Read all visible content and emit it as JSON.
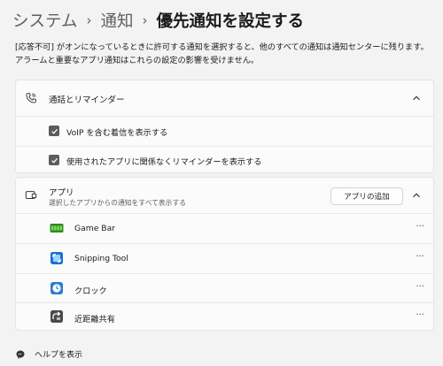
{
  "breadcrumb": {
    "items": [
      "システム",
      "通知"
    ],
    "current": "優先通知を設定する",
    "separator": "›"
  },
  "description": "[応答不可] がオンになっているときに許可する通知を選択すると、他のすべての通知は通知センターに残ります。アラームと重要なアプリ通知はこれらの設定の影響を受けません。",
  "calls_section": {
    "title": "通話とリマインダー",
    "icon": "phone-icon",
    "options": [
      {
        "label": "VoIP を含む着信を表示する",
        "checked": true
      },
      {
        "label": "使用されたアプリに関係なくリマインダーを表示する",
        "checked": true
      }
    ]
  },
  "apps_section": {
    "title": "アプリ",
    "subtitle": "選択したアプリからの通知をすべて表示する",
    "icon": "app-window-icon",
    "add_button": "アプリの追加",
    "apps": [
      {
        "name": "Game Bar",
        "icon": "game-bar-icon",
        "more": "···"
      },
      {
        "name": "Snipping Tool",
        "icon": "snipping-tool-icon",
        "more": "···"
      },
      {
        "name": "クロック",
        "icon": "clock-icon",
        "more": "···"
      },
      {
        "name": "近距離共有",
        "icon": "nearby-share-icon",
        "more": "···"
      }
    ]
  },
  "help": {
    "label": "ヘルプを表示",
    "icon": "help-icon"
  },
  "colors": {
    "background": "#f3f3f3",
    "card": "#fbfbfb",
    "checkbox": "#5c5c5c",
    "game_bar_green": "#3aa829",
    "snipping_blue": "#1b6fd6",
    "clock_blue": "#2b7cd3"
  }
}
